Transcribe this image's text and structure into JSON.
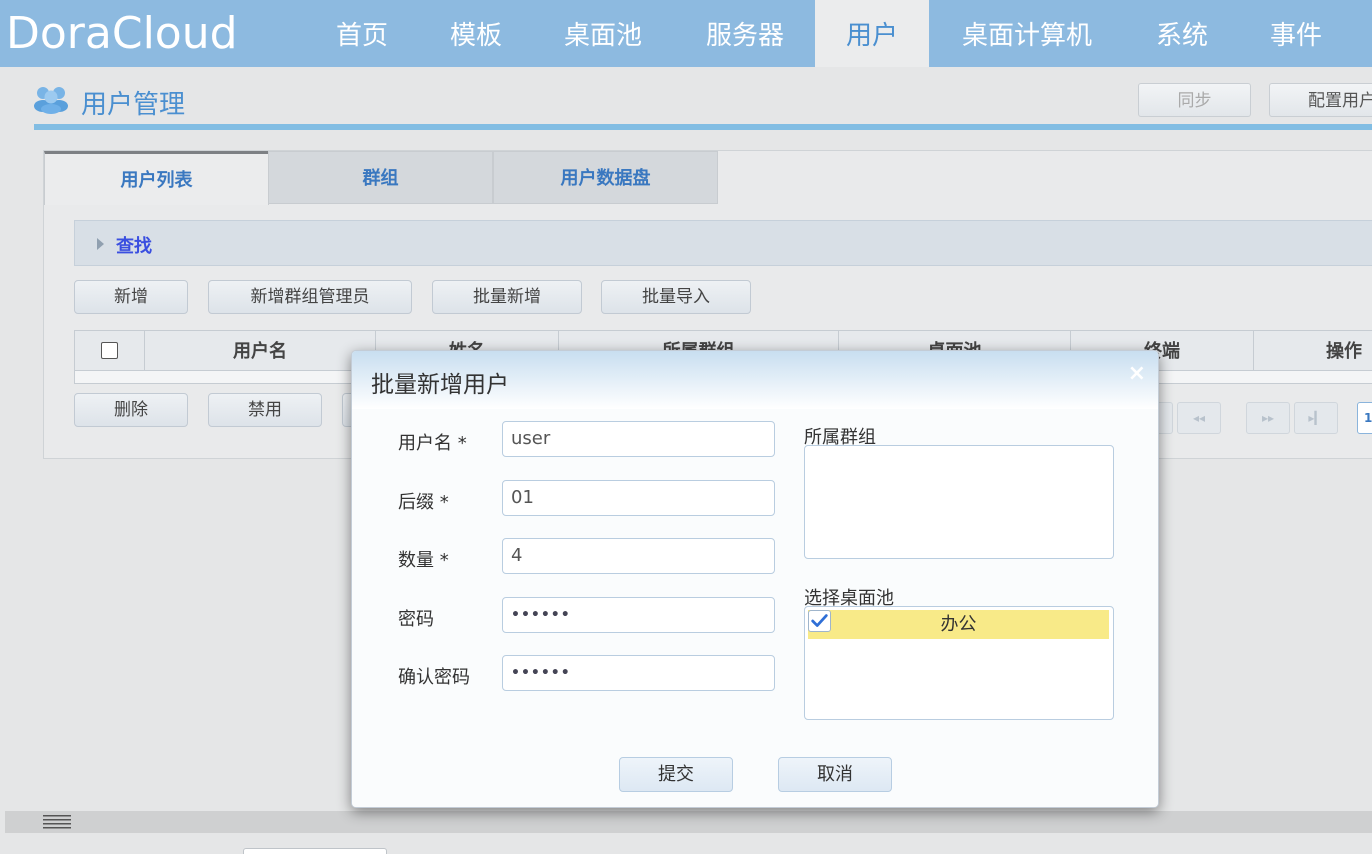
{
  "app": {
    "logo": "DoraCloud"
  },
  "nav": {
    "items": [
      {
        "label": "首页"
      },
      {
        "label": "模板"
      },
      {
        "label": "桌面池"
      },
      {
        "label": "服务器"
      },
      {
        "label": "用户",
        "active": true
      },
      {
        "label": "桌面计算机"
      },
      {
        "label": "系统"
      },
      {
        "label": "事件"
      }
    ]
  },
  "page": {
    "title": "用户管理",
    "icon": "users-icon",
    "sync_label": "同步",
    "config_label": "配置用户"
  },
  "tabs": [
    {
      "label": "用户列表",
      "active": true
    },
    {
      "label": "群组"
    },
    {
      "label": "用户数据盘"
    }
  ],
  "search": {
    "label": "查找"
  },
  "toolbar": {
    "add_label": "新增",
    "add_group_admin_label": "新增群组管理员",
    "batch_add_label": "批量新增",
    "batch_import_label": "批量导入",
    "delete_label": "删除",
    "disable_label": "禁用"
  },
  "table": {
    "columns": [
      "用户名",
      "姓名",
      "所属群组",
      "桌面池",
      "终端",
      "操作"
    ]
  },
  "pager": {
    "first": "◂◂",
    "next": "▸▸",
    "last": "▸▎",
    "page": "1"
  },
  "modal": {
    "title": "批量新增用户",
    "close": "×",
    "fields": {
      "username_label": "用户名 *",
      "username_value": "user",
      "suffix_label": "后缀 *",
      "suffix_value": "01",
      "count_label": "数量 *",
      "count_value": "4",
      "password_label": "密码",
      "password_value": "••••••",
      "confirm_label": "确认密码",
      "confirm_value": "••••••"
    },
    "group_label": "所属群组",
    "pool_label": "选择桌面池",
    "pools": [
      {
        "name": "办公",
        "checked": true
      }
    ],
    "submit_label": "提交",
    "cancel_label": "取消"
  },
  "colors": {
    "nav_bg": "#8dbae0",
    "accent": "#4a8fd0",
    "selected_pool": "#f8ea88"
  }
}
